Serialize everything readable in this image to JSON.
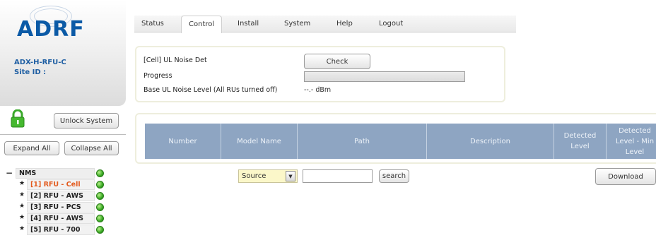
{
  "brand": {
    "logo_text": "ADRF"
  },
  "device": {
    "name": "ADX-H-RFU-C",
    "site_id_label": "Site ID :"
  },
  "left_panel": {
    "unlock_label": "Unlock System",
    "expand_label": "Expand All",
    "collapse_label": "Collapse All",
    "tree": {
      "root_toggle": "−",
      "root_label": "NMS",
      "items": [
        {
          "star": "★",
          "label": "[1] RFU - Cell",
          "active": true,
          "status": "ok"
        },
        {
          "star": "★",
          "label": "[2] RFU - AWS",
          "active": false,
          "status": "ok"
        },
        {
          "star": "★",
          "label": "[3] RFU - PCS",
          "active": false,
          "status": "ok"
        },
        {
          "star": "★",
          "label": "[4] RFU - AWS",
          "active": false,
          "status": "ok"
        },
        {
          "star": "★",
          "label": "[5] RFU - 700",
          "active": false,
          "status": "ok"
        }
      ]
    }
  },
  "tabs": [
    {
      "label": "Status",
      "active": false
    },
    {
      "label": "Control",
      "active": true
    },
    {
      "label": "Install",
      "active": false
    },
    {
      "label": "System",
      "active": false
    },
    {
      "label": "Help",
      "active": false
    },
    {
      "label": "Logout",
      "active": false
    }
  ],
  "noise": {
    "detect_label": "[Cell] UL Noise Det",
    "check_label": "Check",
    "progress_label": "Progress",
    "progress_value": 0,
    "base_label": "Base UL Noise Level (All RUs turned off)",
    "base_value": "--.- dBm"
  },
  "table": {
    "columns": [
      "Number",
      "Model Name",
      "Path",
      "Description",
      "Detected Level",
      "Detected Level - Min Level"
    ]
  },
  "search": {
    "source_value": "Source",
    "select_arrow": "▼",
    "input_value": "",
    "search_label": "search",
    "download_label": "Download"
  },
  "colors": {
    "brand_blue": "#0b5aa6",
    "table_header": "#8ea5c2",
    "active_item": "#e35b1e",
    "status_ok": "#39a924",
    "source_select_bg": "#fbf7c9"
  }
}
